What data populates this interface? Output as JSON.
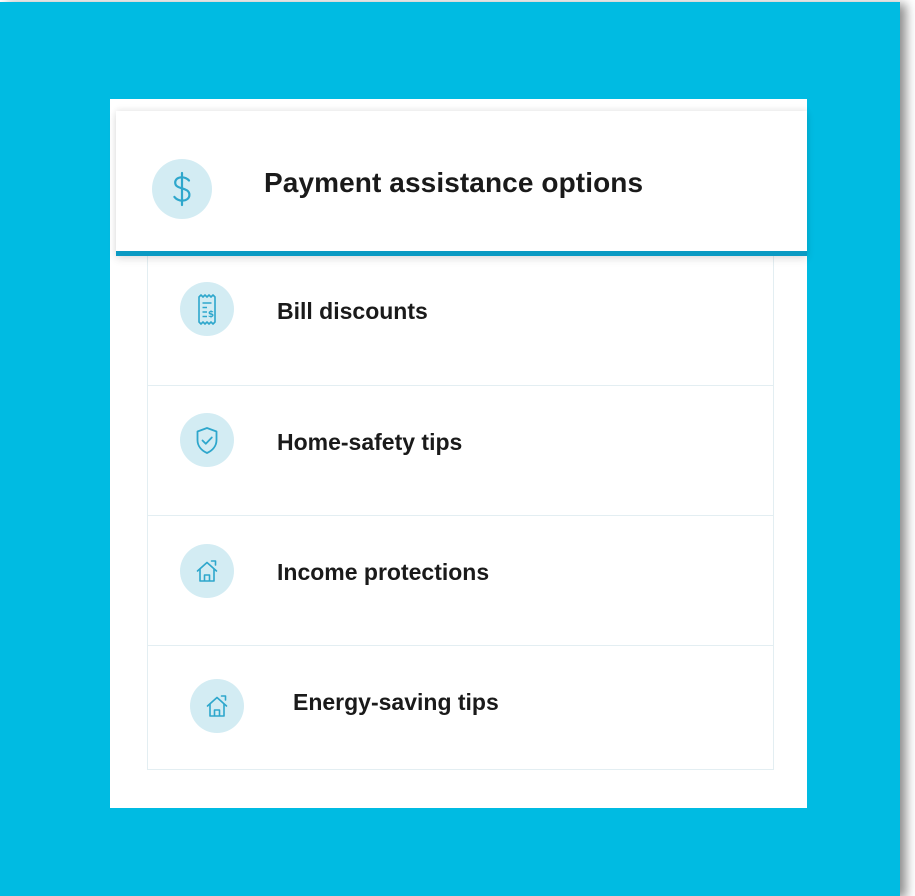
{
  "panel": {
    "header": {
      "title": "Payment assistance options",
      "icon": "dollar-sign-icon"
    },
    "items": [
      {
        "label": "Bill discounts",
        "icon": "receipt-dollar-icon"
      },
      {
        "label": "Home-safety tips",
        "icon": "shield-check-icon"
      },
      {
        "label": "Income protections",
        "icon": "house-icon"
      },
      {
        "label": "Energy-saving tips",
        "icon": "house-icon"
      }
    ]
  },
  "colors": {
    "background": "#00bbe2",
    "accent": "#0a9ac3",
    "icon_bg": "#d3ecf3",
    "icon_stroke": "#2ea7cc",
    "text": "#1a1a1a"
  }
}
